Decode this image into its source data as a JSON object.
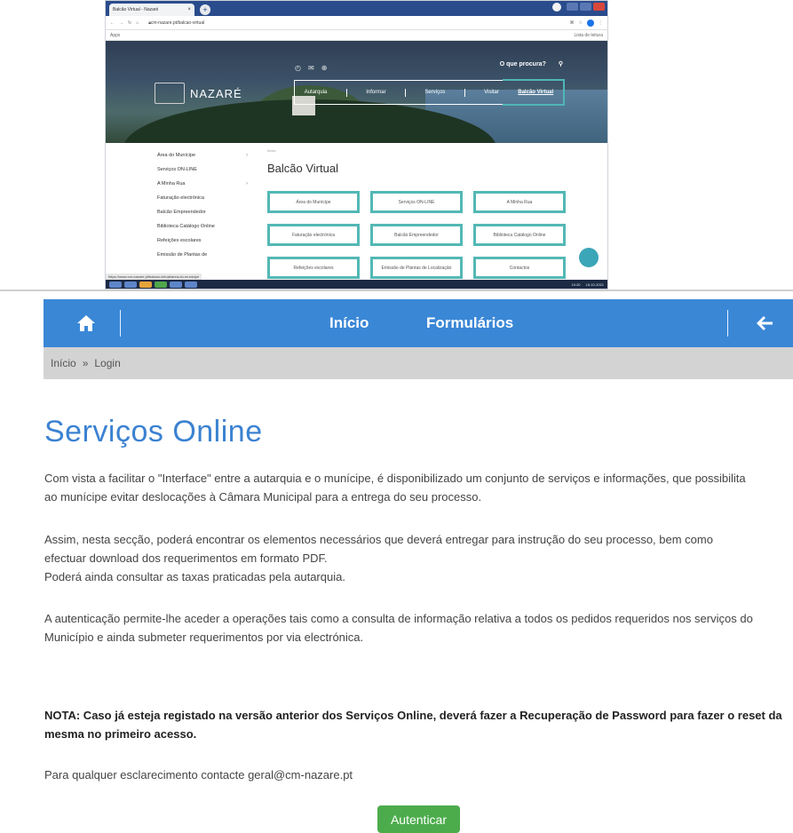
{
  "browser": {
    "tab_title": "Balcão Virtual - Nazaré",
    "window_title": "",
    "address": "cm-nazare.pt/balcao-virtual",
    "bookmarks_left": "Apps",
    "bookmarks_right": "Lista de leitura"
  },
  "site": {
    "brand": "NAZARÉ",
    "search_label": "O que procura?",
    "nav": [
      "Autarquia",
      "Informar",
      "Serviços",
      "Visitar",
      "Balcão Virtual"
    ],
    "sidebar": [
      "Área do Munícipe",
      "Serviços ON-LINE",
      "A Minha Rua",
      "Faturação electrónica",
      "Balcão Empreendedor",
      "Biblioteca Catálogo Online",
      "Refeições escolares",
      "Emissão de Plantas de"
    ],
    "crumb": "Início",
    "heading": "Balcão Virtual",
    "cards": [
      "Área do Munícipe",
      "Serviços ON-LINE",
      "A Minha Rua",
      "Faturação electrónica",
      "Balcão Empreendedor",
      "Biblioteca Catálogo Online",
      "Refeições escolares",
      "Emissão de Plantas de Localização",
      "Contactos"
    ],
    "status_url": "https://www.cm-nazare.pt/balcao-virtual/area-do-municipe",
    "clock": "10:20",
    "date": "18-10-2021"
  },
  "topbar": {
    "link_home": "Início",
    "link_forms": "Formulários"
  },
  "breadcrumb": {
    "home": "Início",
    "sep": "»",
    "current": "Login"
  },
  "page": {
    "title": "Serviços Online",
    "p1": [
      "Com vista a facilitar o \"Interface\" entre a autarquia e o munícipe, é disponibilizado um conjunto de serviços e informações, que possibilita",
      "ao munícipe evitar deslocações à Câmara Municipal para a entrega do seu processo."
    ],
    "p2": [
      "Assim, nesta secção, poderá encontrar os elementos necessários que deverá entregar para instrução do seu processo, bem como",
      "efectuar download dos requerimentos em formato PDF.",
      "Poderá ainda consultar as taxas praticadas pela autarquia."
    ],
    "p3": [
      "A autenticação permite-lhe aceder a operações tais como a consulta de informação relativa a todos os pedidos requeridos nos serviços do",
      "Município e ainda submeter requerimentos por via electrónica."
    ],
    "p4": [
      "NOTA: Caso já esteja registado na versão anterior dos Serviços Online, deverá fazer a Recuperação de Password para fazer o reset da",
      "mesma no primeiro acesso."
    ],
    "p5": "Para qualquer esclarecimento contacte geral@cm-nazare.pt",
    "button": "Autenticar"
  },
  "colors": {
    "topbar": "#3a87d6",
    "title": "#3b82d1",
    "button": "#4cac4c",
    "card_border": "#53b8b5"
  }
}
